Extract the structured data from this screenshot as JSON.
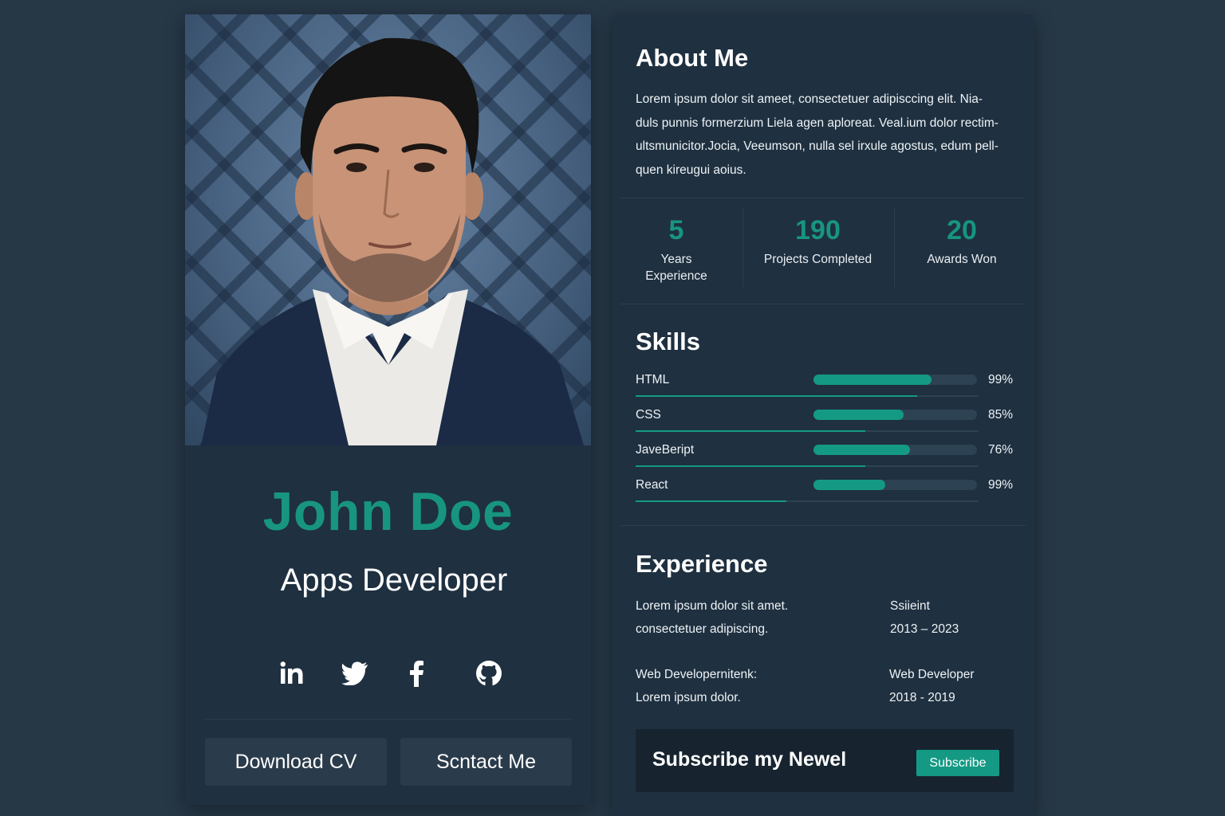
{
  "profile": {
    "name": "John Doe",
    "role": "Apps Developer",
    "socials": [
      {
        "icon": "linkedin-icon"
      },
      {
        "icon": "twitter-icon"
      },
      {
        "icon": "facebook-icon"
      },
      {
        "icon": "github-icon"
      }
    ],
    "download_cv_label": "Download CV",
    "contact_label": "Scntact Me"
  },
  "about": {
    "title": "About Me",
    "lines": [
      "Lorem ipsum dolor sit ameet, consectetuer adipisccing elit. Nia-",
      "duls punnis formerzium Liela agen aploreat. Veal.ium dolor rectim-",
      "ultsmunicitor.Jocia, Veeumson, nulla sel irxule agostus, edum pell-",
      "quen kireugui aoius."
    ]
  },
  "stats": [
    {
      "value": "5",
      "label_lines": [
        "Years",
        "Experience"
      ]
    },
    {
      "value": "190",
      "label_lines": [
        "Projects Completed"
      ]
    },
    {
      "value": "20",
      "label_lines": [
        "Awards Won"
      ]
    }
  ],
  "skills": {
    "title": "Skills",
    "items": [
      {
        "name": "HTML",
        "percent_label": "99%",
        "bar_fill": 0.72,
        "line_fill": 0.82
      },
      {
        "name": "CSS",
        "percent_label": "85%",
        "bar_fill": 0.55,
        "line_fill": 0.67
      },
      {
        "name": "JaveBeript",
        "percent_label": "76%",
        "bar_fill": 0.59,
        "line_fill": 0.67
      },
      {
        "name": "React",
        "percent_label": "99%",
        "bar_fill": 0.44,
        "line_fill": 0.44
      }
    ]
  },
  "experience": {
    "title": "Experience",
    "entries": [
      {
        "desc": [
          "Lorem ipsum dolor sit amet.",
          "consectetuer adipiscing."
        ],
        "title": "Ssiieint",
        "years": "2013  – 2023"
      },
      {
        "desc": [
          "Web Developernitenk:",
          "Lorem ipsum dolor."
        ],
        "title": "Web Developer",
        "years": "2018 - 2019"
      }
    ]
  },
  "subscribe": {
    "title": "Subscribe my Newel",
    "button_label": "Subscribe"
  },
  "colors": {
    "background": "#263746",
    "card": "#1f3040",
    "accent": "#17957f",
    "track": "#2d4252"
  }
}
